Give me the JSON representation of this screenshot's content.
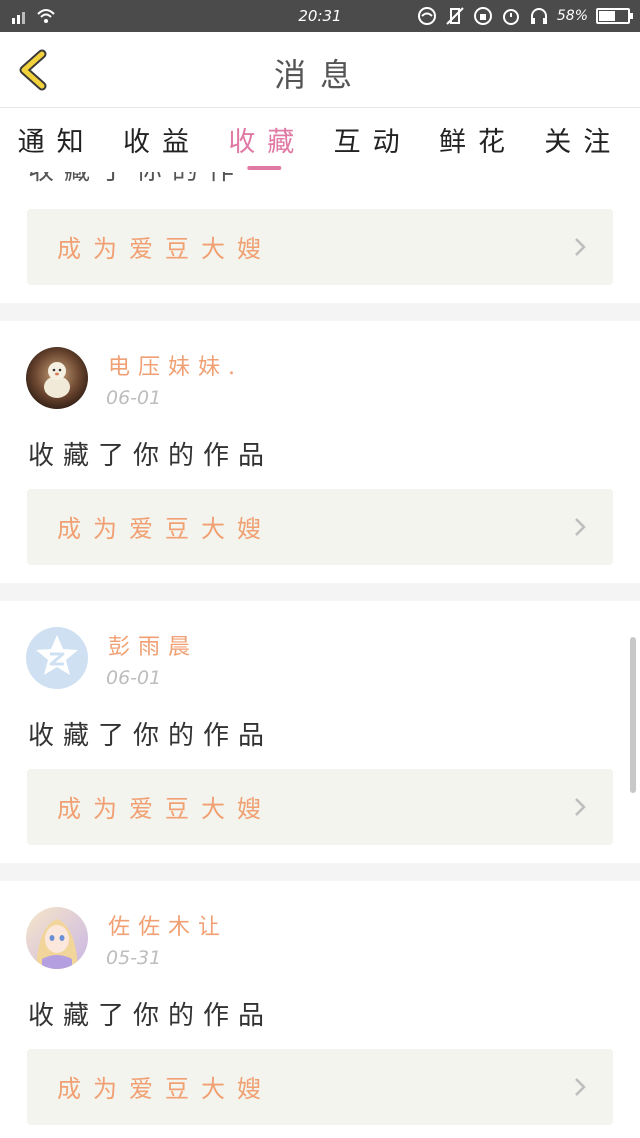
{
  "status_bar": {
    "time": "20:31",
    "battery": "58%",
    "battery_level": 0.58
  },
  "header": {
    "title": "消息"
  },
  "tabs": [
    {
      "label": "通知",
      "active": false
    },
    {
      "label": "收益",
      "active": false
    },
    {
      "label": "收藏",
      "active": true
    },
    {
      "label": "互动",
      "active": false
    },
    {
      "label": "鲜花",
      "active": false
    },
    {
      "label": "关注",
      "active": false
    }
  ],
  "partial_item": {
    "action": "收藏了你的作品",
    "promo": "成为爱豆大嫂"
  },
  "items": [
    {
      "username": "电压妹妹.",
      "date": "06-01",
      "action": "收藏了你的作品",
      "promo": "成为爱豆大嫂"
    },
    {
      "username": "彭雨晨",
      "date": "06-01",
      "action": "收藏了你的作品",
      "promo": "成为爱豆大嫂"
    },
    {
      "username": "佐佐木让",
      "date": "05-31",
      "action": "收藏了你的作品",
      "promo": "成为爱豆大嫂"
    }
  ],
  "colors": {
    "accent_pink": "#e07aa4",
    "promo_orange": "#f0a073",
    "back_yellow": "#f2d23c",
    "status_bar": "#4b4b4b"
  }
}
